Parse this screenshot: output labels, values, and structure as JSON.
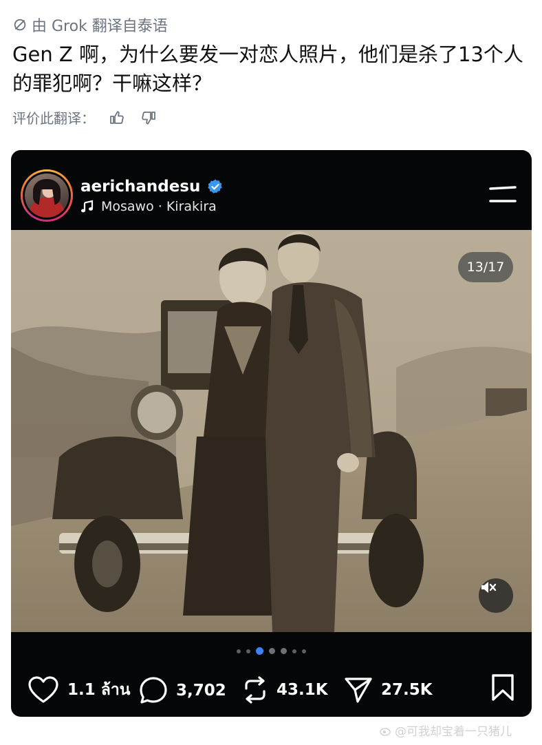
{
  "translation_header": {
    "text": "由 Grok 翻译自泰语"
  },
  "post": {
    "text": "Gen Z 啊，为什么要发一对恋人照片，他们是杀了13个人的罪犯啊？干嘛这样？"
  },
  "rating": {
    "label": "评价此翻译：",
    "like_icon": "thumbs-up-icon",
    "dislike_icon": "thumbs-down-icon"
  },
  "embed": {
    "username": "aerichandesu",
    "music": "Mosawo · Kirakira",
    "page_indicator": "13/17",
    "active_dot_index": 2,
    "actions": {
      "likes": "1.1 ล้าน",
      "comments": "3,702",
      "reposts": "43.1K",
      "shares": "27.5K"
    }
  },
  "watermark": {
    "text": "@可我却宝着一只猪儿"
  },
  "colors": {
    "accent": "#3d82f6",
    "verified": "#3897f0",
    "embed_bg": "#050607",
    "muted_text": "#6b7480"
  }
}
